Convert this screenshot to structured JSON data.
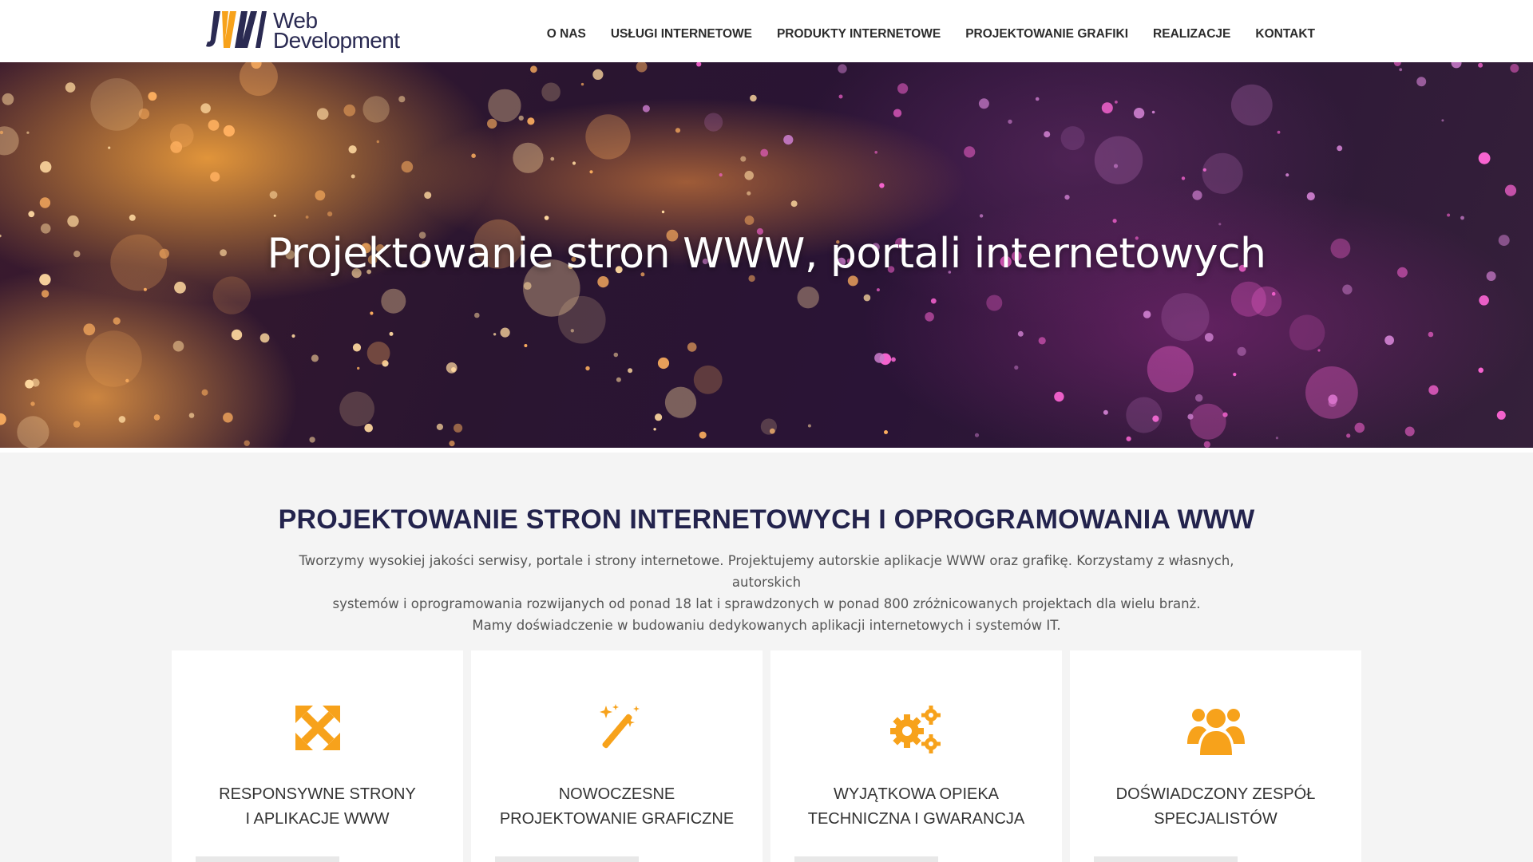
{
  "header": {
    "logo": {
      "line1": "Web",
      "line2": "Development",
      "mark_icon": "jw-logo-mark"
    },
    "nav": [
      {
        "label": "O NAS"
      },
      {
        "label": "USŁUGI INTERNETOWE"
      },
      {
        "label": "PRODUKTY INTERNETOWE"
      },
      {
        "label": "PROJEKTOWANIE GRAFIKI"
      },
      {
        "label": "REALIZACJE"
      },
      {
        "label": "KONTAKT"
      }
    ]
  },
  "hero": {
    "title": "Projektowanie stron WWW, portali internetowych"
  },
  "intro": {
    "title": "PROJEKTOWANIE STRON INTERNETOWYCH I OPROGRAMOWANIA WWW",
    "line1": "Tworzymy wysokiej jakości serwisy, portale i strony internetowe. Projektujemy autorskie aplikacje WWW oraz grafikę. Korzystamy z własnych, autorskich",
    "line2": "systemów i oprogramowania rozwijanych od ponad 18 lat i sprawdzonych w ponad 800 zróżnicowanych projektach dla wielu branż.",
    "line3": "Mamy doświadczenie w budowaniu dedykowanych aplikacji internetowych i systemów IT."
  },
  "features": [
    {
      "icon": "expand-arrows-icon",
      "title_line1": "RESPONSYWNE STRONY",
      "title_line2": "I APLIKACJE WWW"
    },
    {
      "icon": "magic-wand-icon",
      "title_line1": "NOWOCZESNE",
      "title_line2": "PROJEKTOWANIE GRAFICZNE"
    },
    {
      "icon": "gears-icon",
      "title_line1": "WYJĄTKOWA OPIEKA",
      "title_line2": "TECHNICZNA I GWARANCJA"
    },
    {
      "icon": "users-group-icon",
      "title_line1": "DOŚWIADCZONY ZESPÓŁ",
      "title_line2": "SPECJALISTÓW"
    }
  ],
  "colors": {
    "accent": "#f7a21b",
    "heading": "#23234d",
    "logo_dark": "#2a2a52"
  }
}
